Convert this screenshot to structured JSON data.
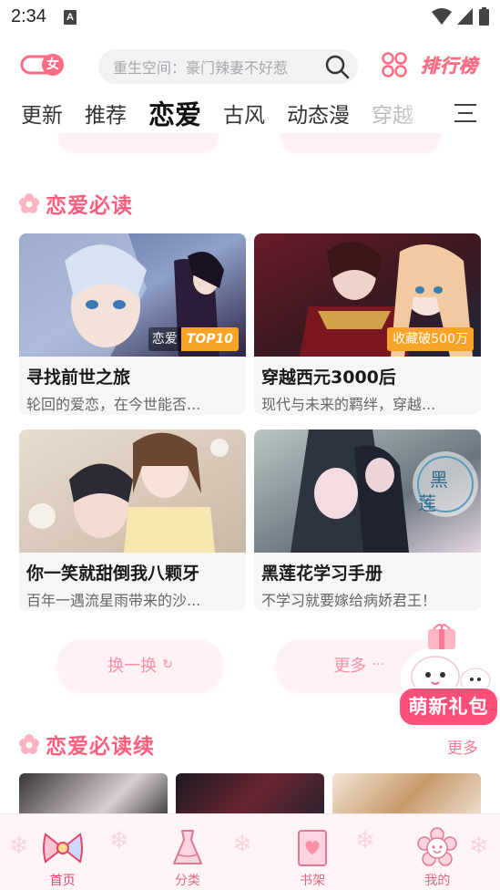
{
  "status_bar": {
    "time": "2:34",
    "notification_letter": "A"
  },
  "top_bar": {
    "gender_label": "女",
    "search_placeholder": "重生空间：豪门辣妻不好惹",
    "ranking_label": "排行榜"
  },
  "tabs": [
    {
      "label": "更新",
      "active": false
    },
    {
      "label": "推荐",
      "active": false
    },
    {
      "label": "恋爱",
      "active": true
    },
    {
      "label": "古风",
      "active": false
    },
    {
      "label": "动态漫",
      "active": false
    },
    {
      "label": "穿越",
      "active": false
    }
  ],
  "section1": {
    "title": "恋爱必读",
    "cards": [
      {
        "title": "寻找前世之旅",
        "desc": "轮回的爱恋，在今世能否...",
        "tag_type": "恋爱",
        "tag_rank": "TOP10"
      },
      {
        "title": "穿越西元3000后",
        "desc": "现代与未来的羁绊，穿越...",
        "tag_fav": "收藏破500万"
      },
      {
        "title": "你一笑就甜倒我八颗牙",
        "desc": "百年一遇流星雨带来的沙..."
      },
      {
        "title": "黑莲花学习手册",
        "desc": "不学习就要嫁给病娇君王！"
      }
    ],
    "refresh_label": "换一换",
    "more_label": "更多"
  },
  "gift": {
    "label": "萌新礼包"
  },
  "section2": {
    "title": "恋爱必读续",
    "more_label": "更多"
  },
  "bottom_nav": [
    {
      "label": "首页",
      "icon": "home-bow-icon",
      "active": true
    },
    {
      "label": "分类",
      "icon": "dress-icon",
      "active": false
    },
    {
      "label": "书架",
      "icon": "book-heart-icon",
      "active": false
    },
    {
      "label": "我的",
      "icon": "flower-face-icon",
      "active": false
    }
  ],
  "colors": {
    "accent": "#ff5f7d",
    "tag_orange": "#f7a328",
    "nav_bg": "#fff5f7"
  }
}
